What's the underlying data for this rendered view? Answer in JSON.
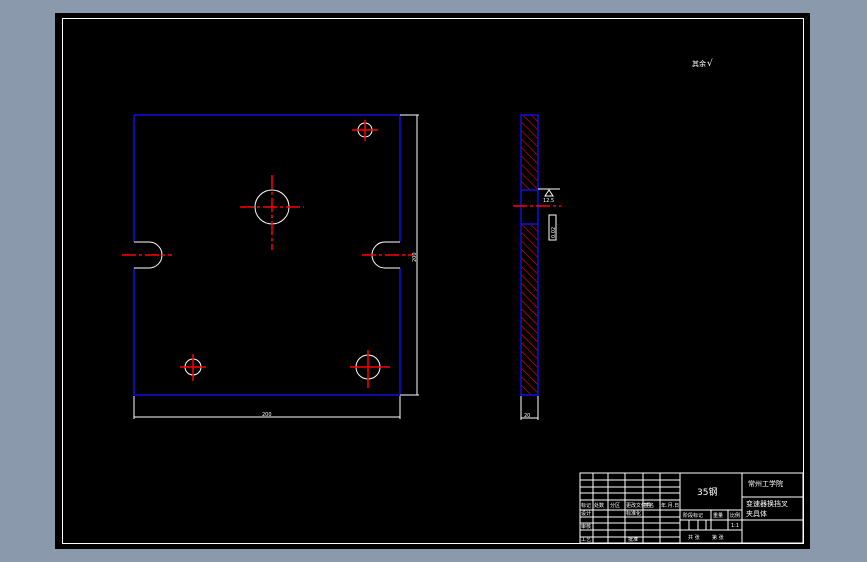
{
  "drawing": {
    "roughness_note": "其余",
    "roughness_symbol": "√",
    "dim_width": "200",
    "dim_height": "200",
    "dim_thickness": "20",
    "roughness_value": "12.5",
    "tolerance_box": "0.02"
  },
  "title_block": {
    "material": "35钢",
    "school": "常州工学院",
    "title_line1": "变速器换挡叉",
    "title_line2": "夹具体",
    "rows": {
      "mark": "标记",
      "count": "处数",
      "zone": "分区",
      "change_doc": "更改文件号",
      "signature": "签名",
      "date": "年.月.日",
      "design": "设计",
      "standard": "标准化",
      "review": "审核",
      "process": "工艺",
      "approve": "批准",
      "stage_mark": "阶段标记",
      "weight": "重量",
      "scale": "比例",
      "scale_value": "1:1",
      "sheets_total": "共  张",
      "sheet_no": "第  张"
    }
  }
}
